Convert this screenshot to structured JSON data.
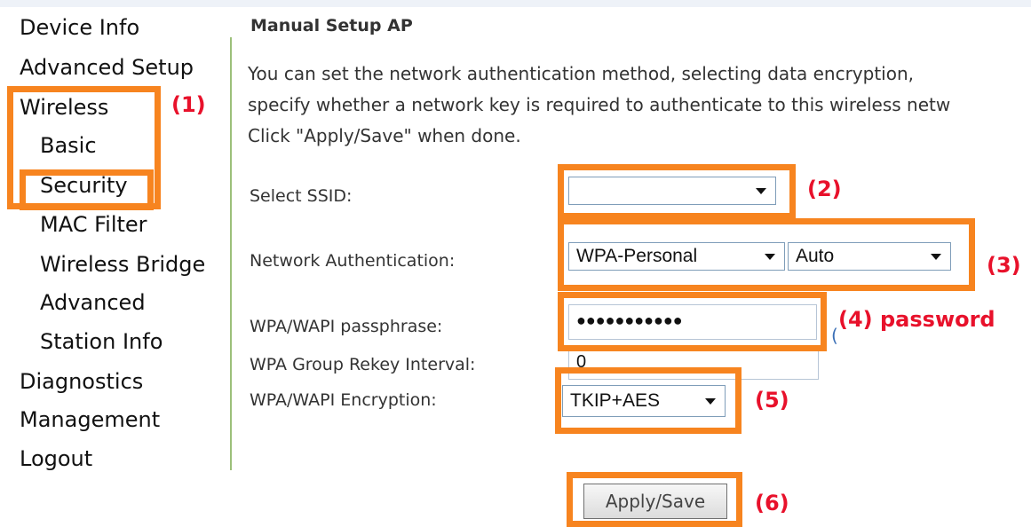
{
  "sidebar": {
    "items": [
      {
        "label": "Device Info"
      },
      {
        "label": "Advanced Setup"
      },
      {
        "label": "Wireless"
      },
      {
        "label": "Basic"
      },
      {
        "label": "Security"
      },
      {
        "label": "MAC Filter"
      },
      {
        "label": "Wireless Bridge"
      },
      {
        "label": "Advanced"
      },
      {
        "label": "Station Info"
      },
      {
        "label": "Diagnostics"
      },
      {
        "label": "Management"
      },
      {
        "label": "Logout"
      }
    ]
  },
  "main": {
    "title": "Manual Setup AP",
    "description": [
      "You can set the network authentication method, selecting data encryption,",
      "specify whether a network key is required to authenticate to this wireless netw",
      "Click \"Apply/Save\" when done."
    ],
    "fields": {
      "ssid": {
        "label": "Select SSID:",
        "value": ""
      },
      "auth": {
        "label": "Network Authentication:",
        "value": "WPA-Personal",
        "mode_value": "Auto"
      },
      "passphrase": {
        "label": "WPA/WAPI passphrase:",
        "value": "●●●●●●●●●●●",
        "stray_char": "("
      },
      "rekey": {
        "label": "WPA Group Rekey Interval:",
        "value": "0"
      },
      "encryption": {
        "label": "WPA/WAPI Encryption:",
        "value": "TKIP+AES"
      }
    },
    "apply_label": "Apply/Save"
  },
  "annotations": {
    "m1": "(1)",
    "m2": "(2)",
    "m3": "(3)",
    "m4": "(4) password",
    "m5": "(5)",
    "m6": "(6)"
  },
  "colors": {
    "annotation_border": "#f7841f",
    "annotation_text": "#e8112b",
    "sidebar_divider": "#9cc07a"
  }
}
